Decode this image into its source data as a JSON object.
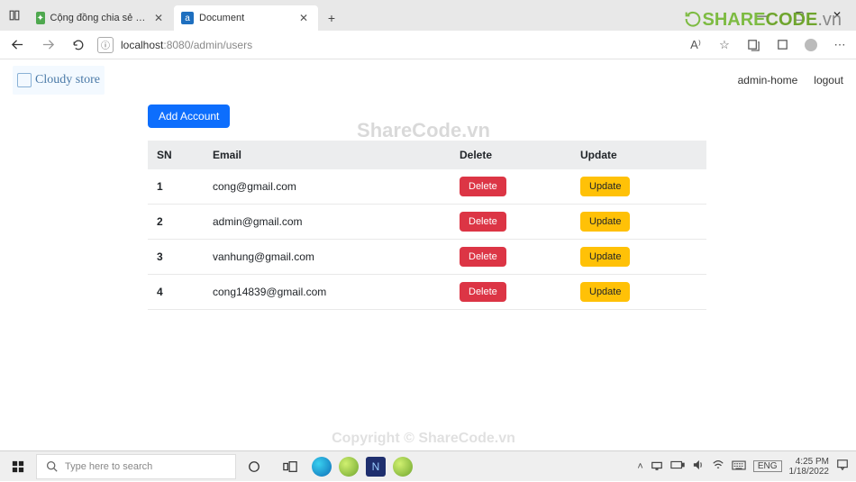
{
  "browser": {
    "tabs": [
      {
        "title": "Cộng đồng chia sẻ và download",
        "favicon": "green"
      },
      {
        "title": "Document",
        "favicon": "blue"
      }
    ],
    "new_tab_label": "+",
    "window": {
      "min": "—",
      "max": "▢",
      "close": "✕"
    },
    "url": {
      "host": "localhost",
      "port": ":8080",
      "path": "/admin/users"
    }
  },
  "watermark": {
    "center": "ShareCode.vn",
    "bottom": "Copyright © ShareCode.vn",
    "brand_1": "SHARE",
    "brand_2": "CODE",
    "brand_tld": ".vn"
  },
  "page": {
    "logo_text": "Cloudy store",
    "nav": {
      "home": "admin-home",
      "logout": "logout"
    },
    "add_btn": "Add Account",
    "columns": {
      "sn": "SN",
      "email": "Email",
      "delete": "Delete",
      "update": "Update"
    },
    "delete_btn": "Delete",
    "update_btn": "Update",
    "rows": [
      {
        "sn": "1",
        "email": "cong@gmail.com"
      },
      {
        "sn": "2",
        "email": "admin@gmail.com"
      },
      {
        "sn": "3",
        "email": "vanhung@gmail.com"
      },
      {
        "sn": "4",
        "email": "cong14839@gmail.com"
      }
    ]
  },
  "taskbar": {
    "search_placeholder": "Type here to search",
    "lang": "ENG",
    "time": "4:25 PM",
    "date": "1/18/2022"
  }
}
